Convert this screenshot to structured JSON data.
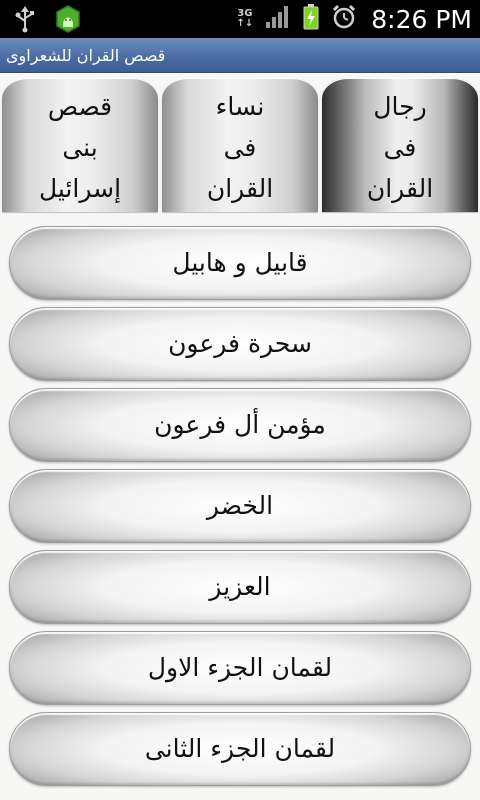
{
  "status_bar": {
    "usb_icon": "usb-icon",
    "notification_icon": "android-notification-icon",
    "network_type_top": "3G",
    "network_arrows": "↑↓",
    "signal_icon": "signal-bars-icon",
    "battery_icon": "battery-charging-icon",
    "alarm_icon": "alarm-clock-icon",
    "time": "8:26 PM"
  },
  "title_bar": {
    "title": "قصص القران للشعراوى"
  },
  "tabs": [
    {
      "lines": [
        "رجال",
        "فى",
        "القران"
      ],
      "selected": true
    },
    {
      "lines": [
        "نساء",
        "فى",
        "القران"
      ],
      "selected": false
    },
    {
      "lines": [
        "قصص",
        "بنى",
        "إسرائيل"
      ],
      "selected": false
    }
  ],
  "list_items": [
    "قابيل و هابيل",
    "سحرة فرعون",
    "مؤمن أل فرعون",
    "الخضر",
    "العزيز",
    "لقمان الجزء الاول",
    "لقمان الجزء الثانى"
  ],
  "colors": {
    "status_bar_bg": "#000000",
    "title_bar_bg": "#4a6aa2",
    "battery_green": "#7ed321",
    "notification_green": "#4caf2b"
  }
}
